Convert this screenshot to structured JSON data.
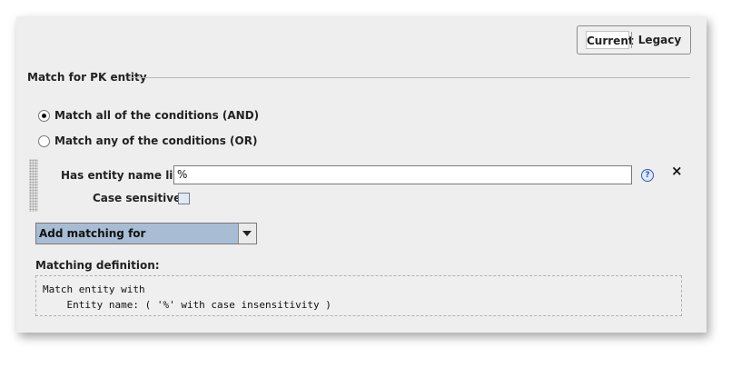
{
  "toggles": {
    "current": "Current",
    "legacy": "Legacy"
  },
  "section": {
    "title": "Match for PK entity"
  },
  "radios": [
    {
      "label": "Match all of the conditions (AND)",
      "checked": true
    },
    {
      "label": "Match any of the conditions (OR)",
      "checked": false
    }
  ],
  "condition": {
    "name_label": "Has entity name like:",
    "name_value": "%",
    "case_label": "Case sensitive",
    "case_checked": false
  },
  "add_matching": {
    "label": "Add matching for"
  },
  "definition": {
    "label": "Matching definition:",
    "lines": [
      "Match entity with",
      "    Entity name: ( '%' with case insensitivity )"
    ]
  }
}
